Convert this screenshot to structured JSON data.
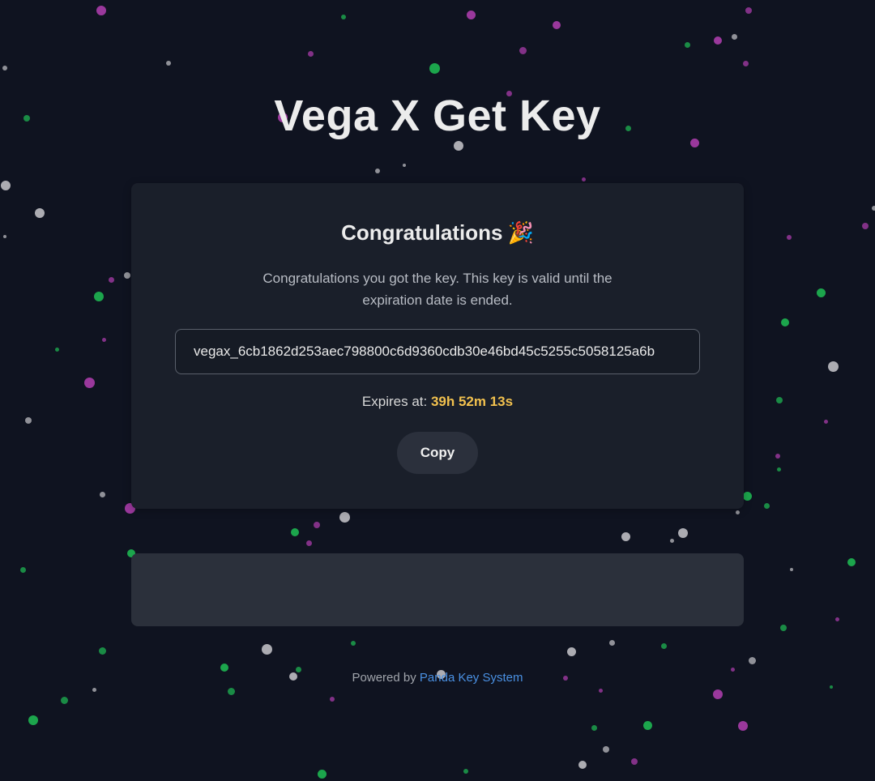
{
  "page": {
    "title": "Vega X Get Key"
  },
  "card": {
    "heading": "Congratulations",
    "heading_icon": "party-popper-icon",
    "message": "Congratulations you got the key. This key is valid until the expiration date is ended.",
    "key_value": "vegax_6cb1862d253aec798800c6d9360cdb30e46bd45c5255c5058125a6b",
    "expires_label": "Expires at:",
    "expires_value": "39h 52m 13s",
    "copy_label": "Copy"
  },
  "footer": {
    "prefix": "Powered by",
    "link_text": "Panda Key System"
  },
  "colors": {
    "background": "#0f1320",
    "card": "#1a1f2a",
    "accent_timer": "#f2c14e",
    "link": "#4a90e2",
    "confetti": [
      "#b33fb3",
      "#1fbf55",
      "#c8c8cc"
    ]
  }
}
